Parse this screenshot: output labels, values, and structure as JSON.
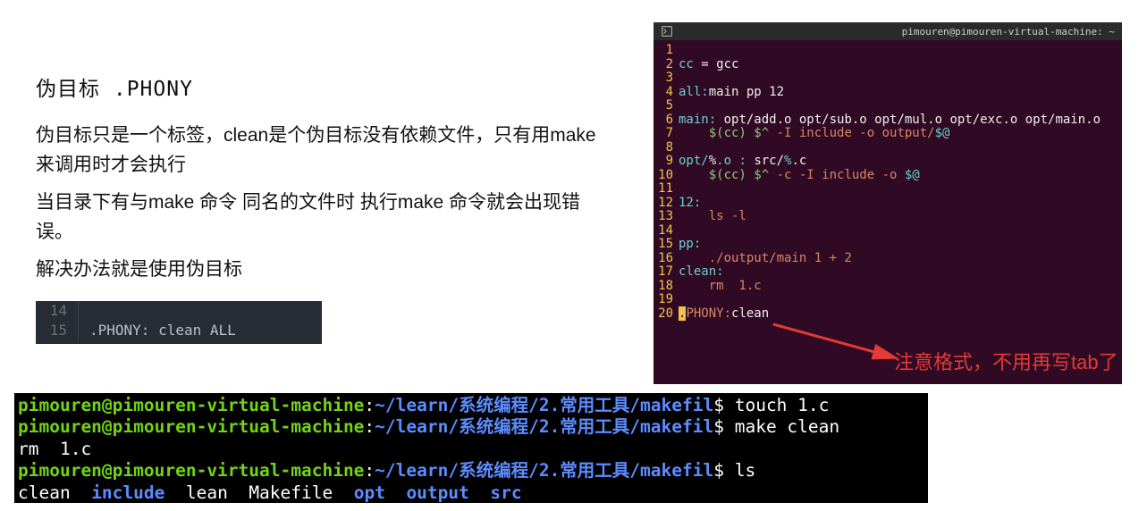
{
  "left": {
    "title": "伪目标  .PHONY",
    "para1": "伪目标只是一个标签，clean是个伪目标没有依赖文件，只有用make来调用时才会执行",
    "para2": "当目录下有与make 命令 同名的文件时 执行make 命令就会出现错误。",
    "para3": "解决办法就是使用伪目标",
    "snippet": {
      "line14no": "14",
      "line14txt": "",
      "line15no": "15",
      "line15txt": ".PHONY: clean ALL"
    }
  },
  "editor": {
    "titlebar_right": "pimouren@pimouren-virtual-machine: ~",
    "lines": {
      "l1": {
        "n": "1",
        "full": ""
      },
      "l2": {
        "n": "2",
        "a": "cc",
        "b": " = gcc"
      },
      "l3": {
        "n": "3",
        "full": ""
      },
      "l4": {
        "n": "4",
        "a": "all:",
        "b": "main pp 12"
      },
      "l5": {
        "n": "5",
        "full": ""
      },
      "l6": {
        "n": "6",
        "a": "main:",
        "b": " opt/add.o opt/sub.o opt/mul.o opt/exc.o opt/main.o"
      },
      "l7": {
        "n": "7",
        "a": "    $(cc) $^",
        "b": " -I include -o output/",
        "c": "$@"
      },
      "l8": {
        "n": "8",
        "full": ""
      },
      "l9": {
        "n": "9",
        "a": "opt/",
        "b": "%",
        "c": ".o : ",
        "d": "src/",
        "e": "%",
        "f": ".c"
      },
      "l10": {
        "n": "10",
        "a": "    $(cc) $^",
        "b": " -c -I include -o ",
        "c": "$@"
      },
      "l11": {
        "n": "11",
        "full": ""
      },
      "l12": {
        "n": "12",
        "a": "12:"
      },
      "l13": {
        "n": "13",
        "a": "    ls -l"
      },
      "l14": {
        "n": "14",
        "full": ""
      },
      "l15": {
        "n": "15",
        "a": "pp:"
      },
      "l16": {
        "n": "16",
        "a": "    ./output/main 1 + 2"
      },
      "l17": {
        "n": "17",
        "a": "clean:"
      },
      "l18": {
        "n": "18",
        "a": "    rm  1.c"
      },
      "l19": {
        "n": "19",
        "full": ""
      },
      "l20": {
        "n": "20",
        "cursor": ".",
        "a": "PHONY:",
        "b": "clean"
      }
    }
  },
  "note_text": "注意格式，不用再写tab了",
  "terminal": {
    "user": "pimouren@pimouren-virtual-machine",
    "colon": ":",
    "path": "~/learn/系统编程/2.常用工具/makefil",
    "dollar": "$ ",
    "cmd1": "touch 1.c",
    "cmd2": "make clean",
    "out2": "rm  1.c",
    "cmd3": "ls",
    "ls_plain1": "clean  ",
    "ls_include": "include",
    "ls_gap1": "  ",
    "ls_lean": "lean  ",
    "ls_make": "Makefile  ",
    "ls_opt": "opt",
    "ls_gap2": "  ",
    "ls_output": "output",
    "ls_gap3": "  ",
    "ls_src": "src"
  }
}
